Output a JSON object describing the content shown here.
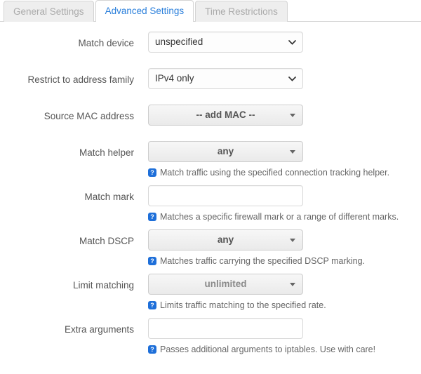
{
  "tabs": [
    {
      "label": "General Settings",
      "active": false
    },
    {
      "label": "Advanced Settings",
      "active": true
    },
    {
      "label": "Time Restrictions",
      "active": false
    }
  ],
  "colors": {
    "active_tab_text": "#2a7fdb",
    "inactive_tab_text": "#aaaaaa",
    "help_icon_bg": "#1e6fd9",
    "label_text": "#555555"
  },
  "fields": {
    "match_device": {
      "label": "Match device",
      "value": "unspecified",
      "icon": "chevron-down-icon"
    },
    "address_family": {
      "label": "Restrict to address family",
      "value": "IPv4 only",
      "icon": "chevron-down-icon"
    },
    "source_mac": {
      "label": "Source MAC address",
      "value": "-- add MAC --",
      "icon": "caret-down-icon"
    },
    "match_helper": {
      "label": "Match helper",
      "value": "any",
      "icon": "caret-down-icon",
      "help": "Match traffic using the specified connection tracking helper."
    },
    "match_mark": {
      "label": "Match mark",
      "value": "",
      "placeholder": "",
      "help": "Matches a specific firewall mark or a range of different marks."
    },
    "match_dscp": {
      "label": "Match DSCP",
      "value": "any",
      "icon": "caret-down-icon",
      "help": "Matches traffic carrying the specified DSCP marking."
    },
    "limit_matching": {
      "label": "Limit matching",
      "value": "unlimited",
      "icon": "caret-down-icon",
      "help": "Limits traffic matching to the specified rate."
    },
    "extra_arguments": {
      "label": "Extra arguments",
      "value": "",
      "placeholder": "",
      "help": "Passes additional arguments to iptables. Use with care!"
    }
  },
  "help_icon_glyph": "?"
}
